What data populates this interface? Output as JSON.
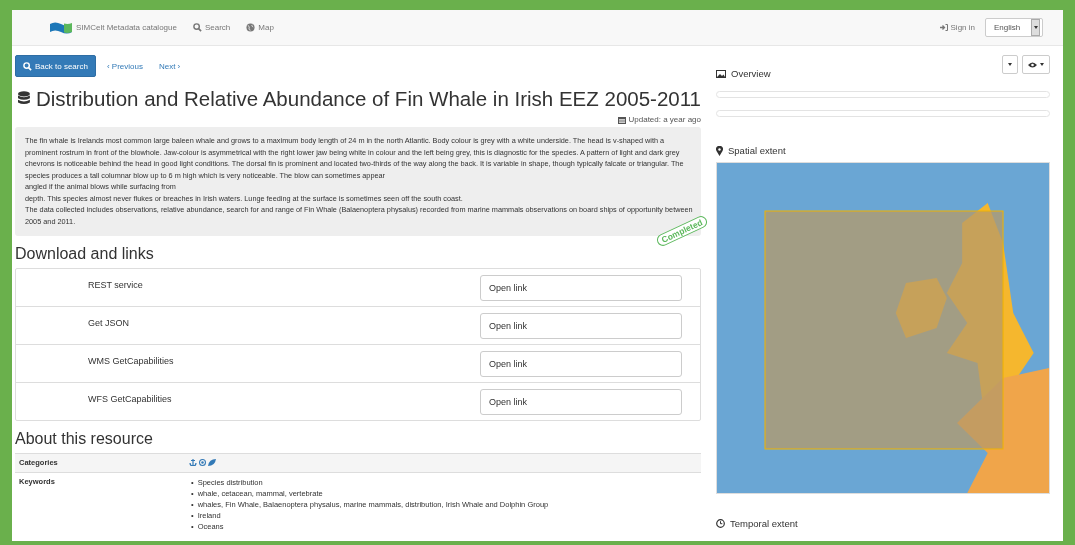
{
  "nav": {
    "brand": "SIMCelt Metadata catalogue",
    "links": [
      {
        "kind": "search",
        "label": "Search"
      },
      {
        "kind": "map",
        "label": "Map"
      }
    ],
    "sign_in": "Sign in",
    "language": "English"
  },
  "toolbar": {
    "back": "Back to search",
    "previous": "‹ Previous",
    "next": "Next ›"
  },
  "title": "Distribution and Relative Abundance of Fin Whale in Irish EEZ 2005-2011",
  "updated": "Updated: a year ago",
  "description": [
    "The fin whale is Irelands most common large baleen whale and grows to a maximum body length of 24 m in the north Atlantic. Body colour is grey with a white underside. The head is v-shaped with a prominent rostrum in front of the blowhole. Jaw-colour is asymmetrical with the right lower jaw being white in colour and the left being grey, this is diagnostic for the species. A pattern of light and dark grey chevrons is noticeable behind the head in good light conditions. The dorsal fin is prominent and located two-thirds of the way along the back. It is variable in shape, though typically falcate or triangular. The species produces a tall columnar blow up to 6 m high which is very noticeable. The blow can sometimes appear",
    "angled if the animal blows while surfacing from",
    "depth. This species almost never flukes or breaches in Irish waters. Lunge feeding at the surface is sometimes seen off the south coast.",
    "The data collected includes observations, relative abundance, search for and range of Fin Whale (Balaenoptera physalus) recorded from marine mammals observations on board ships of opportunity between 2005 and 2011."
  ],
  "status_stamp": "Completed",
  "downloads": {
    "heading": "Download and links",
    "items": [
      {
        "name": "REST service",
        "action": "Open link"
      },
      {
        "name": "Get JSON",
        "action": "Open link"
      },
      {
        "name": "WMS GetCapabilities",
        "action": "Open link"
      },
      {
        "name": "WFS GetCapabilities",
        "action": "Open link"
      }
    ]
  },
  "about": {
    "heading": "About this resource",
    "rows": [
      {
        "kind": "icons",
        "label": "Categories"
      },
      {
        "kind": "list",
        "label": "Keywords",
        "marker": "•",
        "items": [
          "Species distribution",
          "whale, cetacean, mammal, vertebrate",
          "whales, Fin Whale, Balaenoptera physalus, marine mammals, distribution, Irish Whale and Dolphin Group",
          "Ireland",
          "Oceans"
        ]
      }
    ]
  },
  "sidebar": {
    "overview": "Overview",
    "spatial_extent": "Spatial extent",
    "temporal_extent": "Temporal extent"
  }
}
